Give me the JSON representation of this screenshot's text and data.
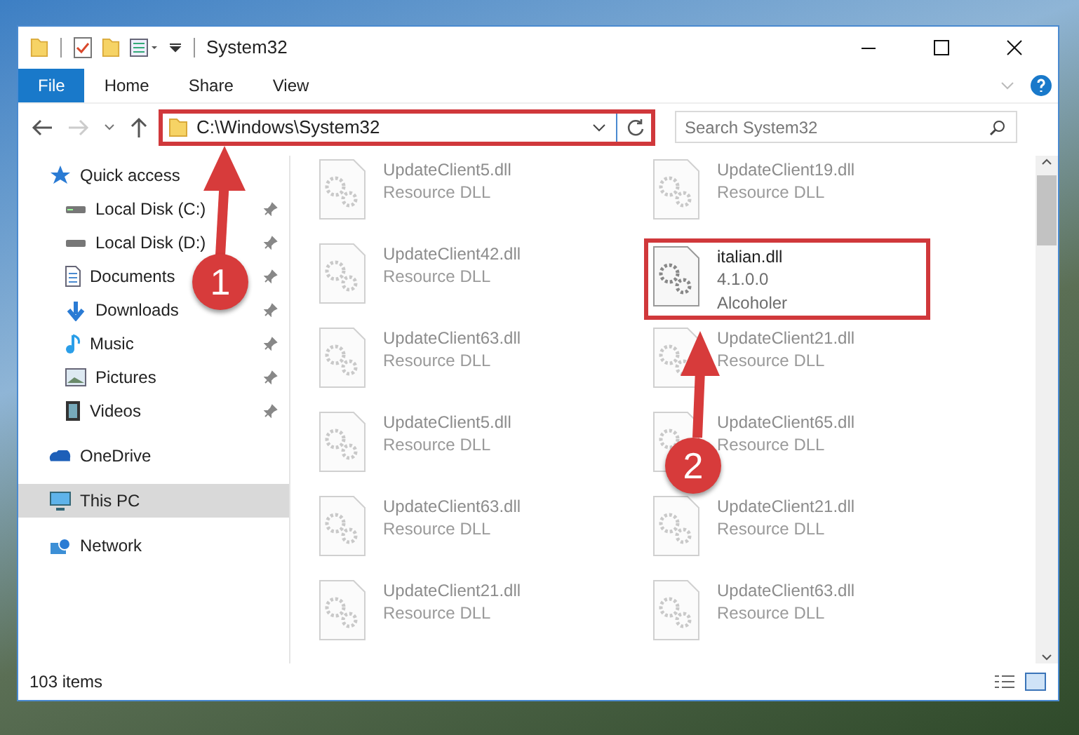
{
  "window": {
    "title": "System32"
  },
  "ribbon_tabs": [
    {
      "label": "File",
      "selected": true
    },
    {
      "label": "Home",
      "selected": false
    },
    {
      "label": "Share",
      "selected": false
    },
    {
      "label": "View",
      "selected": false
    }
  ],
  "address": {
    "value": "C:\\Windows\\System32",
    "highlighted": true
  },
  "search": {
    "placeholder": "Search System32"
  },
  "sidebar": {
    "items": [
      {
        "label": "Quick access",
        "selected": false,
        "children": [
          {
            "label": "Local Disk (C:)",
            "pinned": true
          },
          {
            "label": "Local Disk (D:)",
            "pinned": true
          },
          {
            "label": "Documents",
            "pinned": true
          },
          {
            "label": "Downloads",
            "pinned": true
          },
          {
            "label": "Music",
            "pinned": true
          },
          {
            "label": "Pictures",
            "pinned": true
          },
          {
            "label": "Videos",
            "pinned": true
          }
        ]
      },
      {
        "label": "OneDrive",
        "selected": false
      },
      {
        "label": "This PC",
        "selected": true
      },
      {
        "label": "Network",
        "selected": false
      }
    ]
  },
  "files": [
    {
      "name": "UpdateClient5.dll",
      "lines": [
        "Resource DLL"
      ],
      "kind": "faded"
    },
    {
      "name": "UpdateClient19.dll",
      "lines": [
        "Resource DLL"
      ],
      "kind": "faded"
    },
    {
      "name": "UpdateClient42.dll",
      "lines": [
        "Resource DLL"
      ],
      "kind": "faded"
    },
    {
      "name": "italian.dll",
      "lines": [
        "4.1.0.0",
        "Alcoholer"
      ],
      "kind": "highlighted"
    },
    {
      "name": "UpdateClient63.dll",
      "lines": [
        "Resource DLL"
      ],
      "kind": "faded"
    },
    {
      "name": "UpdateClient21.dll",
      "lines": [
        "Resource DLL"
      ],
      "kind": "faded"
    },
    {
      "name": "UpdateClient5.dll",
      "lines": [
        "Resource DLL"
      ],
      "kind": "faded"
    },
    {
      "name": "UpdateClient65.dll",
      "lines": [
        "Resource DLL"
      ],
      "kind": "faded"
    },
    {
      "name": "UpdateClient63.dll",
      "lines": [
        "Resource DLL"
      ],
      "kind": "faded"
    },
    {
      "name": "UpdateClient21.dll",
      "lines": [
        "Resource DLL"
      ],
      "kind": "faded"
    },
    {
      "name": "UpdateClient21.dll",
      "lines": [
        "Resource DLL"
      ],
      "kind": "faded"
    },
    {
      "name": "UpdateClient63.dll",
      "lines": [
        "Resource DLL"
      ],
      "kind": "faded"
    }
  ],
  "status_bar": {
    "text": "103 items"
  },
  "annotations": [
    {
      "label": "1"
    },
    {
      "label": "2"
    }
  ]
}
